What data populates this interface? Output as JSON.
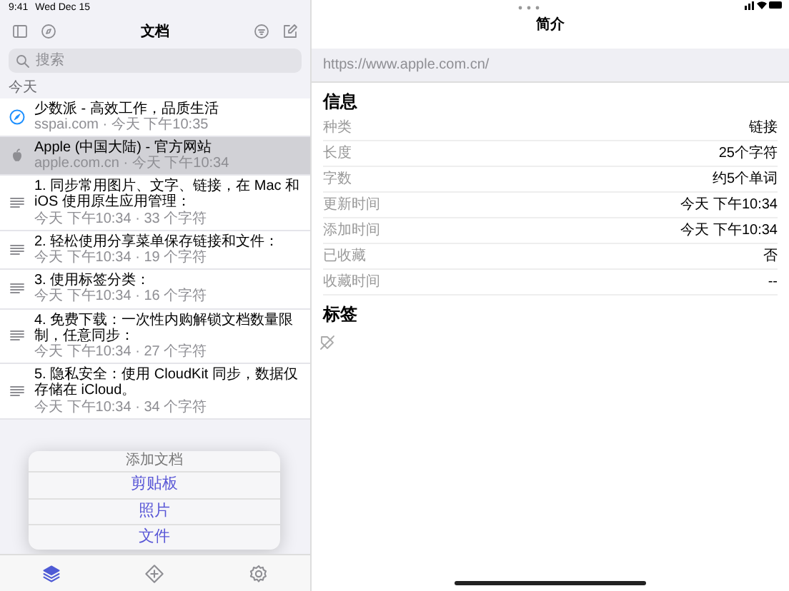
{
  "status_bar": {
    "time": "9:41",
    "date": "Wed Dec 15"
  },
  "sidebar": {
    "title": "文档",
    "search": {
      "placeholder": "搜索"
    },
    "section": "今天",
    "items": [
      {
        "kind": "web",
        "title": "少数派 - 高效工作，品质生活",
        "meta": "sspai.com · 今天 下午10:35",
        "selected": false
      },
      {
        "kind": "apple",
        "title": "Apple (中国大陆) - 官方网站",
        "meta": "apple.com.cn · 今天 下午10:34",
        "selected": true
      },
      {
        "kind": "text",
        "title": "1. 同步常用图片、文字、链接，在 Mac 和 iOS 使用原生应用管理：",
        "meta": "今天 下午10:34 · 33 个字符",
        "selected": false
      },
      {
        "kind": "text",
        "title": "2. 轻松使用分享菜单保存链接和文件：",
        "meta": "今天 下午10:34 · 19 个字符",
        "selected": false
      },
      {
        "kind": "text",
        "title": "3. 使用标签分类：",
        "meta": "今天 下午10:34 · 16 个字符",
        "selected": false
      },
      {
        "kind": "text",
        "title": "4. 免费下载：一次性内购解锁文档数量限制，任意同步：",
        "meta": "今天 下午10:34 · 27 个字符",
        "selected": false
      },
      {
        "kind": "text",
        "title": "5. 隐私安全：使用 CloudKit 同步，数据仅存储在 iCloud。",
        "meta": "今天 下午10:34 · 34 个字符",
        "selected": false
      }
    ]
  },
  "popover": {
    "title": "添加文档",
    "options": [
      "剪贴板",
      "照片",
      "文件"
    ]
  },
  "tab_bar": {
    "tabs": [
      {
        "kind": "library",
        "selected": true
      },
      {
        "kind": "add",
        "selected": false
      },
      {
        "kind": "settings",
        "selected": false
      }
    ]
  },
  "detail": {
    "title": "简介",
    "url": "https://www.apple.com.cn/",
    "info_heading": "信息",
    "info": [
      {
        "label": "种类",
        "value": "链接"
      },
      {
        "label": "长度",
        "value": "25个字符"
      },
      {
        "label": "字数",
        "value": "约5个单词"
      },
      {
        "label": "更新时间",
        "value": "今天 下午10:34"
      },
      {
        "label": "添加时间",
        "value": "今天 下午10:34"
      },
      {
        "label": "已收藏",
        "value": "否"
      },
      {
        "label": "收藏时间",
        "value": "--"
      }
    ],
    "tags_heading": "标签"
  }
}
